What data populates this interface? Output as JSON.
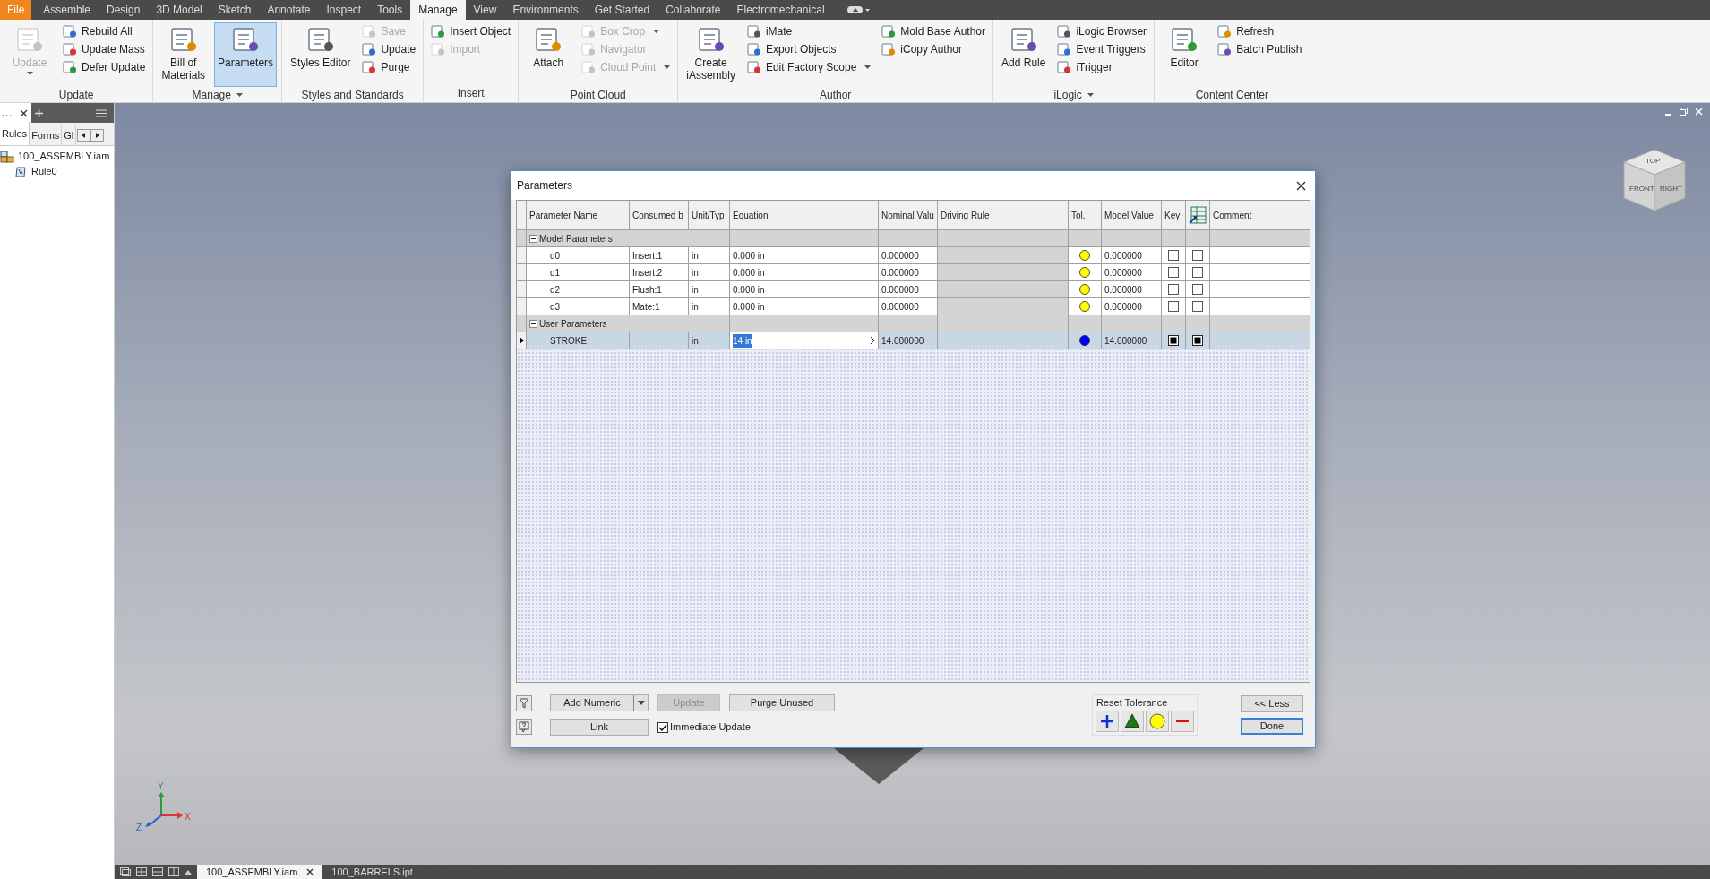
{
  "menu_tabs": [
    {
      "label": "File",
      "kind": "file",
      "selected": false
    },
    {
      "label": "Assemble",
      "kind": "tab",
      "selected": false
    },
    {
      "label": "Design",
      "kind": "tab",
      "selected": false
    },
    {
      "label": "3D Model",
      "kind": "tab",
      "selected": false
    },
    {
      "label": "Sketch",
      "kind": "tab",
      "selected": false
    },
    {
      "label": "Annotate",
      "kind": "tab",
      "selected": false
    },
    {
      "label": "Inspect",
      "kind": "tab",
      "selected": false
    },
    {
      "label": "Tools",
      "kind": "tab",
      "selected": false
    },
    {
      "label": "Manage",
      "kind": "tab",
      "selected": true
    },
    {
      "label": "View",
      "kind": "tab",
      "selected": false
    },
    {
      "label": "Environments",
      "kind": "tab",
      "selected": false
    },
    {
      "label": "Get Started",
      "kind": "tab",
      "selected": false
    },
    {
      "label": "Collaborate",
      "kind": "tab",
      "selected": false
    },
    {
      "label": "Electromechanical",
      "kind": "tab",
      "selected": false
    }
  ],
  "ribbon_panels": [
    {
      "title": "Update",
      "menu": false,
      "columns": [
        {
          "kind": "large",
          "items": [
            {
              "label": "Update",
              "disabled": true,
              "menu": true,
              "selected": false
            }
          ]
        },
        {
          "kind": "small",
          "items": [
            {
              "label": "Rebuild All",
              "disabled": false,
              "menu": false,
              "selected": false
            },
            {
              "label": "Update Mass",
              "disabled": false,
              "menu": false,
              "selected": false
            },
            {
              "label": "Defer Update",
              "disabled": false,
              "menu": false,
              "selected": false
            }
          ]
        }
      ]
    },
    {
      "title": "Manage",
      "menu": true,
      "columns": [
        {
          "kind": "large",
          "items": [
            {
              "label": "Bill of\nMaterials",
              "disabled": false,
              "menu": false,
              "selected": false
            }
          ]
        },
        {
          "kind": "large",
          "items": [
            {
              "label": "Parameters",
              "disabled": false,
              "menu": false,
              "selected": true
            }
          ]
        }
      ]
    },
    {
      "title": "Styles and Standards",
      "menu": false,
      "columns": [
        {
          "kind": "large",
          "items": [
            {
              "label": "Styles Editor",
              "disabled": false,
              "menu": false,
              "selected": false
            }
          ]
        },
        {
          "kind": "small",
          "items": [
            {
              "label": "Save",
              "disabled": true,
              "menu": false,
              "selected": false
            },
            {
              "label": "Update",
              "disabled": false,
              "menu": false,
              "selected": false
            },
            {
              "label": "Purge",
              "disabled": false,
              "menu": false,
              "selected": false
            }
          ]
        }
      ]
    },
    {
      "title": "Insert",
      "menu": false,
      "columns": [
        {
          "kind": "small",
          "items": [
            {
              "label": "Insert Object",
              "disabled": false,
              "menu": false,
              "selected": false
            },
            {
              "label": "Import",
              "disabled": true,
              "menu": false,
              "selected": false
            }
          ]
        }
      ]
    },
    {
      "title": "Point Cloud",
      "menu": false,
      "columns": [
        {
          "kind": "large",
          "items": [
            {
              "label": "Attach",
              "disabled": false,
              "menu": false,
              "selected": false
            }
          ]
        },
        {
          "kind": "small",
          "items": [
            {
              "label": "Box Crop",
              "disabled": true,
              "menu": true,
              "selected": false
            },
            {
              "label": "Navigator",
              "disabled": true,
              "menu": false,
              "selected": false
            },
            {
              "label": "Cloud Point",
              "disabled": true,
              "menu": true,
              "selected": false
            }
          ]
        }
      ]
    },
    {
      "title": "Author",
      "menu": false,
      "columns": [
        {
          "kind": "large",
          "items": [
            {
              "label": "Create\niAssembly",
              "disabled": false,
              "menu": false,
              "selected": false
            }
          ]
        },
        {
          "kind": "small",
          "items": [
            {
              "label": "iMate",
              "disabled": false,
              "menu": false,
              "selected": false
            },
            {
              "label": "Export Objects",
              "disabled": false,
              "menu": false,
              "selected": false
            },
            {
              "label": "Edit Factory Scope",
              "disabled": false,
              "menu": true,
              "selected": false
            }
          ]
        },
        {
          "kind": "small",
          "items": [
            {
              "label": "Mold Base Author",
              "disabled": false,
              "menu": false,
              "selected": false
            },
            {
              "label": "iCopy Author",
              "disabled": false,
              "menu": false,
              "selected": false
            }
          ]
        }
      ]
    },
    {
      "title": "iLogic",
      "menu": true,
      "columns": [
        {
          "kind": "large",
          "items": [
            {
              "label": "Add Rule",
              "disabled": false,
              "menu": false,
              "selected": false
            }
          ]
        },
        {
          "kind": "small",
          "items": [
            {
              "label": "iLogic Browser",
              "disabled": false,
              "menu": false,
              "selected": false
            },
            {
              "label": "Event Triggers",
              "disabled": false,
              "menu": false,
              "selected": false
            },
            {
              "label": "iTrigger",
              "disabled": false,
              "menu": false,
              "selected": false
            }
          ]
        }
      ]
    },
    {
      "title": "Content Center",
      "menu": false,
      "columns": [
        {
          "kind": "large",
          "items": [
            {
              "label": "Editor",
              "disabled": false,
              "menu": false,
              "selected": false
            }
          ]
        },
        {
          "kind": "small",
          "items": [
            {
              "label": "Refresh",
              "disabled": false,
              "menu": false,
              "selected": false
            },
            {
              "label": "Batch Publish",
              "disabled": false,
              "menu": false,
              "selected": false
            }
          ]
        }
      ]
    }
  ],
  "browser_panel": {
    "title": "…",
    "tabs": [
      {
        "label": "Rules",
        "selected": true
      },
      {
        "label": "Forms",
        "selected": false
      },
      {
        "label": "Gl",
        "selected": false
      }
    ],
    "tree": [
      {
        "label": "100_ASSEMBLY.iam",
        "kind": "assembly",
        "children": [
          {
            "label": "Rule0",
            "kind": "rule"
          }
        ]
      }
    ]
  },
  "view_cube": {
    "faces": [
      "TOP",
      "FRONT",
      "RIGHT"
    ]
  },
  "axis_labels": {
    "x": "X",
    "y": "Y",
    "z": "Z"
  },
  "dialog": {
    "title": "Parameters",
    "columns": [
      {
        "kind": "text",
        "label": "Parameter Name"
      },
      {
        "kind": "text",
        "label": "Consumed b"
      },
      {
        "kind": "text",
        "label": "Unit/Typ"
      },
      {
        "kind": "text",
        "label": "Equation"
      },
      {
        "kind": "text",
        "label": "Nominal Valu"
      },
      {
        "kind": "text",
        "label": "Driving Rule"
      },
      {
        "kind": "text",
        "label": "Tol."
      },
      {
        "kind": "text",
        "label": "Model Value"
      },
      {
        "kind": "text",
        "label": "Key"
      },
      {
        "kind": "icon"
      },
      {
        "kind": "text",
        "label": "Comment"
      }
    ],
    "groups": [
      {
        "label": "Model Parameters",
        "expanded": true,
        "rows": [
          {
            "name": "d0",
            "consumed_by": "Insert:1",
            "unit": "in",
            "equation": "0.000 in",
            "nominal": "0.000000",
            "color": "#ffff00",
            "model_value": "0.000000",
            "key": false,
            "export": false,
            "selected": false
          },
          {
            "name": "d1",
            "consumed_by": "Insert:2",
            "unit": "in",
            "equation": "0.000 in",
            "nominal": "0.000000",
            "color": "#ffff00",
            "model_value": "0.000000",
            "key": false,
            "export": false,
            "selected": false
          },
          {
            "name": "d2",
            "consumed_by": "Flush:1",
            "unit": "in",
            "equation": "0.000 in",
            "nominal": "0.000000",
            "color": "#ffff00",
            "model_value": "0.000000",
            "key": false,
            "export": false,
            "selected": false
          },
          {
            "name": "d3",
            "consumed_by": "Mate:1",
            "unit": "in",
            "equation": "0.000 in",
            "nominal": "0.000000",
            "color": "#ffff00",
            "model_value": "0.000000",
            "key": false,
            "export": false,
            "selected": false
          }
        ]
      },
      {
        "label": "User Parameters",
        "expanded": true,
        "rows": [
          {
            "name": "STROKE",
            "unit": "in",
            "equation": "14 in",
            "nominal": "14.000000",
            "color": "#0000ff",
            "model_value": "14.000000",
            "key": true,
            "export": true,
            "selected": true
          }
        ]
      }
    ],
    "add_numeric": "Add Numeric",
    "update": {
      "label": "Update",
      "disabled": true
    },
    "purge_unused": "Purge Unused",
    "link": "Link",
    "immediate_update": {
      "label": "Immediate Update",
      "checked": true
    },
    "reset_tolerance": "Reset Tolerance",
    "less": "<< Less",
    "done": "Done"
  },
  "document_tabs": [
    {
      "label": "100_ASSEMBLY.iam",
      "selected": true
    },
    {
      "label": "100_BARRELS.ipt",
      "selected": false
    }
  ]
}
